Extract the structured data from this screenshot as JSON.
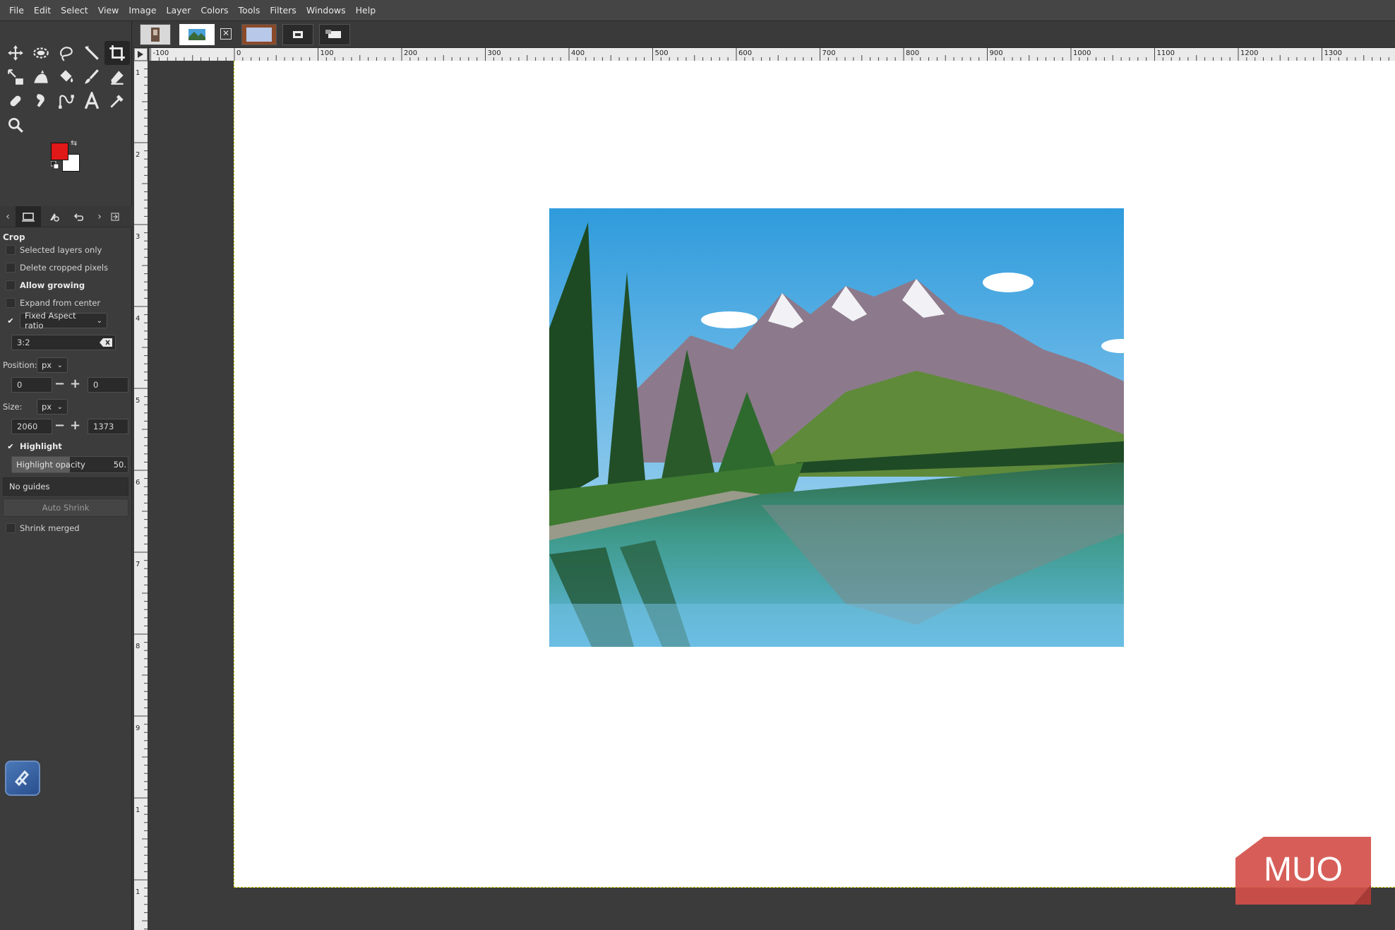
{
  "menu": [
    "File",
    "Edit",
    "Select",
    "View",
    "Image",
    "Layer",
    "Colors",
    "Tools",
    "Filters",
    "Windows",
    "Help"
  ],
  "colors": {
    "foreground": "#e01818",
    "background": "#ffffff"
  },
  "tool_options": {
    "title": "Crop",
    "selected_layers_only": "Selected layers only",
    "delete_cropped_pixels": "Delete cropped pixels",
    "allow_growing": "Allow growing",
    "expand_from_center": "Expand from center",
    "fixed_mode": "Fixed Aspect ratio",
    "aspect_value": "3:2",
    "position_label": "Position:",
    "position_unit": "px",
    "position_x": "0",
    "position_y": "0",
    "size_label": "Size:",
    "size_unit": "px",
    "size_w": "2060",
    "size_h": "1373",
    "highlight": "Highlight",
    "highlight_opacity_label": "Highlight opacity",
    "highlight_opacity_value": "50.",
    "highlight_opacity": 0.5,
    "guides": "No guides",
    "auto_shrink": "Auto Shrink",
    "shrink_merged": "Shrink merged"
  },
  "ruler_h": [
    "-100",
    "0",
    "100",
    "200",
    "300",
    "400",
    "500",
    "600",
    "700",
    "800",
    "900",
    "1000",
    "1100",
    "1200",
    "1300"
  ],
  "ruler_v": [
    "1",
    "2",
    "3",
    "4",
    "5",
    "6",
    "7",
    "8",
    "9",
    "1",
    "1"
  ],
  "watermark": "MUO"
}
